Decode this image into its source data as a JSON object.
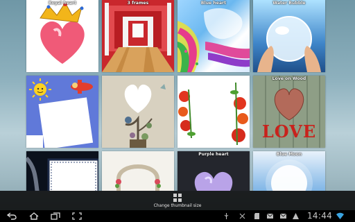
{
  "grid": {
    "tiles": [
      {
        "label": "Royal heart"
      },
      {
        "label": "3 frames"
      },
      {
        "label": "Blue heart"
      },
      {
        "label": "Water Bubble"
      },
      {
        "label": ""
      },
      {
        "label": ""
      },
      {
        "label": ""
      },
      {
        "label": "Love on Wood"
      },
      {
        "label": ""
      },
      {
        "label": ""
      },
      {
        "label": "Purple heart"
      },
      {
        "label": "Blue Moon"
      }
    ],
    "wood_text": "LOVE"
  },
  "toolbar": {
    "change_size_label": "Change thumbnail size",
    "icon": "grid-icon"
  },
  "system_bar": {
    "clock": "14:44",
    "nav_icons": [
      "back-icon",
      "home-icon",
      "recent-apps-icon",
      "screenshot-icon"
    ],
    "status_icons": [
      "usb-icon",
      "debug-icon",
      "sd-card-icon",
      "gmail-icon",
      "gmail-icon",
      "warning-icon",
      "wifi-icon"
    ]
  },
  "colors": {
    "toolbar_bg": "#0a0a0a",
    "system_bar_bg": "#000000",
    "clock": "#c7c7c7"
  }
}
